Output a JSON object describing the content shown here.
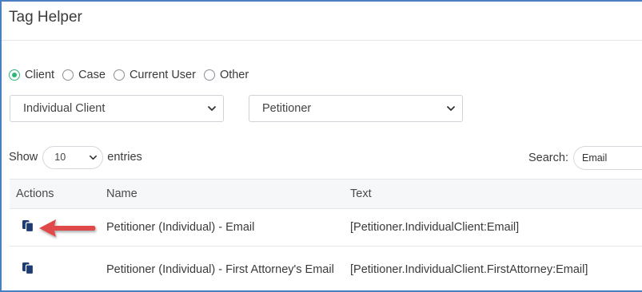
{
  "header": {
    "title": "Tag Helper"
  },
  "radio_group": {
    "options": [
      {
        "label": "Client",
        "checked": true
      },
      {
        "label": "Case",
        "checked": false
      },
      {
        "label": "Current User",
        "checked": false
      },
      {
        "label": "Other",
        "checked": false
      }
    ]
  },
  "filters": {
    "client_type": "Individual Client",
    "role": "Petitioner"
  },
  "table_controls": {
    "show_label": "Show",
    "entries_value": "10",
    "entries_label": "entries",
    "search_label": "Search:",
    "search_value": "Email"
  },
  "table": {
    "headers": [
      "Actions",
      "Name",
      "Text"
    ],
    "rows": [
      {
        "name": "Petitioner (Individual) - Email",
        "text": "[Petitioner.IndividualClient:Email]"
      },
      {
        "name": "Petitioner (Individual) - First Attorney's Email",
        "text": "[Petitioner.IndividualClient.FirstAttorney:Email]"
      }
    ]
  },
  "colors": {
    "accent_green": "#2db679",
    "copy_icon": "#1f3b73",
    "arrow_red": "#e04848",
    "frame_border": "#4a7fc1"
  },
  "icons": {
    "copy": "copy-icon",
    "dropdown": "chevron-down-icon",
    "callout": "arrow-left-icon"
  }
}
